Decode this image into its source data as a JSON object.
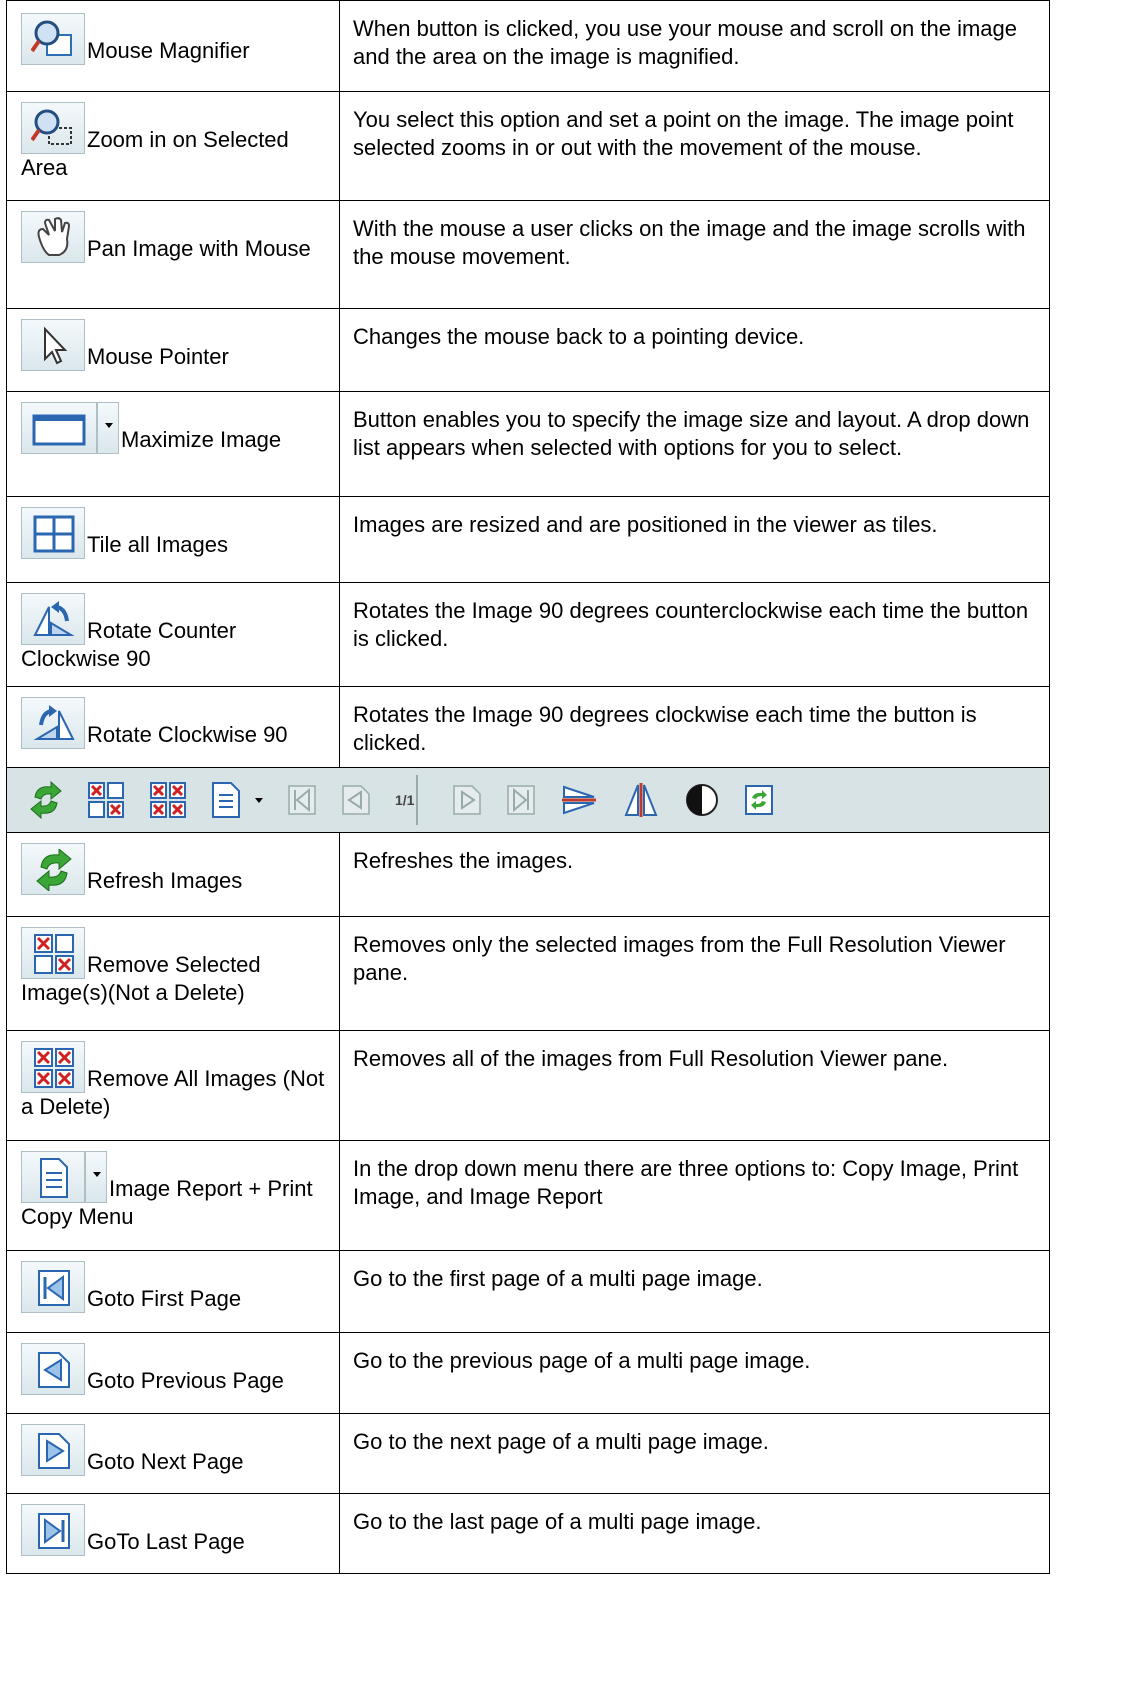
{
  "rows_top": [
    {
      "label": "Mouse Magnifier",
      "description": "When button is clicked, you use your mouse and scroll on the image and the area on the image is magnified.",
      "icon": "magnifier-icon"
    },
    {
      "label": "Zoom in on Selected Area",
      "description": "You select this option and set a point on the image. The image point selected zooms in or out with the movement of the mouse.",
      "icon": "zoom-area-icon"
    },
    {
      "label": "Pan Image with Mouse",
      "description": "With the mouse a user clicks on the image and the image scrolls with the mouse movement.",
      "icon": "hand-icon"
    },
    {
      "label": "Mouse Pointer",
      "description": "Changes the mouse back to a pointing device.",
      "icon": "pointer-icon"
    },
    {
      "label": "Maximize Image",
      "description": "Button enables you to specify the image size and layout. A drop down list appears when selected with options for you to select.",
      "icon": "maximize-icon"
    },
    {
      "label": "Tile all Images",
      "description": "Images are resized and are positioned in the viewer as tiles.",
      "icon": "tile-icon"
    },
    {
      "label": "Rotate Counter Clockwise 90",
      "description": "Rotates the Image 90 degrees counterclockwise each time the button is clicked.",
      "icon": "rotate-ccw-icon"
    },
    {
      "label": "Rotate Clockwise 90",
      "description": "Rotates the Image 90 degrees clockwise each time the button is clicked.",
      "icon": "rotate-cw-icon"
    }
  ],
  "toolbar": {
    "page_indicator": "1/1"
  },
  "rows_bottom": [
    {
      "label": "Refresh Images",
      "description": "Refreshes the images.",
      "icon": "refresh-icon"
    },
    {
      "label": "Remove Selected Image(s)(Not a Delete)",
      "description": "Removes only the selected images from the Full Resolution Viewer pane.",
      "icon": "remove-selected-icon"
    },
    {
      "label": "Remove All Images (Not a Delete)",
      "description": "Removes all of the images from Full Resolution Viewer pane.",
      "icon": "remove-all-icon"
    },
    {
      "label": "Image Report + Print Copy Menu",
      "description": "In the drop down menu there are three options to: Copy Image, Print Image, and Image Report",
      "icon": "report-icon"
    },
    {
      "label": "Goto First Page",
      "description": " Go to the first page of a multi page image.",
      "icon": "first-page-icon"
    },
    {
      "label": "Goto Previous Page",
      "description": "Go to the previous page of a multi page image.",
      "icon": "previous-page-icon"
    },
    {
      "label": "Goto Next Page",
      "description": "Go to the next page of a multi page image.",
      "icon": "next-page-icon"
    },
    {
      "label": "GoTo Last Page",
      "description": "Go to the last page of a multi page image.",
      "icon": "last-page-icon"
    }
  ]
}
